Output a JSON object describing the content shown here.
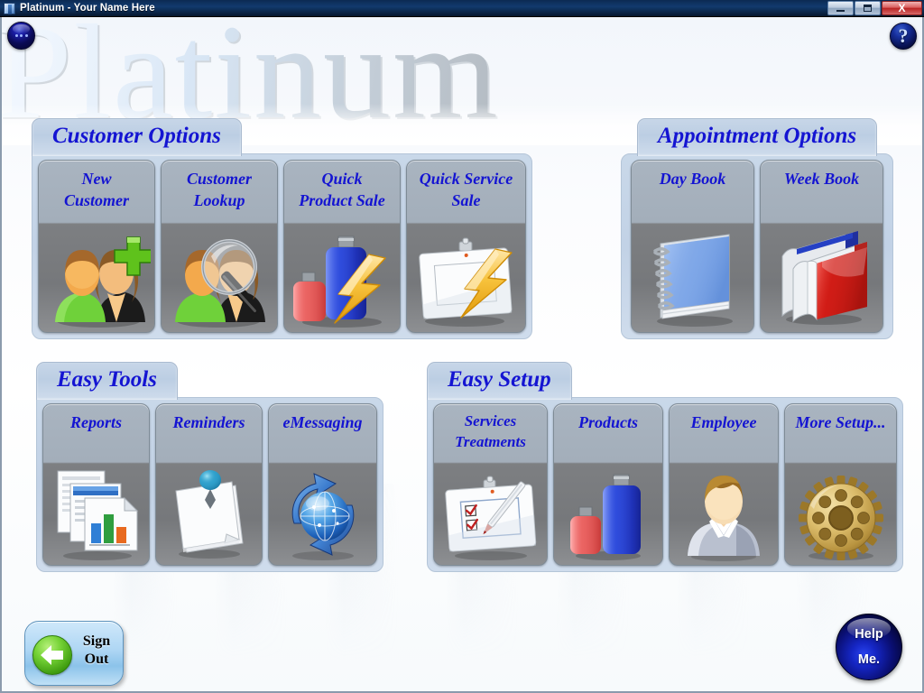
{
  "window": {
    "title": "Platinum - Your Name Here",
    "app_icon": "platinum-app-icon",
    "controls": {
      "minimize": "minimize",
      "maximize": "maximize",
      "close": "X"
    }
  },
  "header": {
    "wordmark": "Platinum",
    "menu_orb": "...",
    "help_orb": "?"
  },
  "colors": {
    "label_blue": "#1414d2",
    "tab_blue_gray": "#c7d6e8",
    "tile_gray_top": "#a9b4c0",
    "tile_gray_bottom": "#76787b",
    "titlebar_blue": "#123a6e",
    "close_red": "#b82222",
    "signout_green": "#3f9c10",
    "help_orb_blue": "#1526c4"
  },
  "groups": [
    {
      "id": "customer-options",
      "title": "Customer Options",
      "tiles": [
        {
          "id": "new-customer",
          "label": "New\nCustomer",
          "icon": "two-users-plus-icon"
        },
        {
          "id": "customer-lookup",
          "label": "Customer\nLookup",
          "icon": "user-magnifier-icon"
        },
        {
          "id": "quick-product-sale",
          "label": "Quick\nProduct Sale",
          "icon": "bottles-lightning-icon"
        },
        {
          "id": "quick-service-sale",
          "label": "Quick Service\nSale",
          "icon": "clipboard-lightning-icon"
        }
      ]
    },
    {
      "id": "appointment-options",
      "title": "Appointment Options",
      "tiles": [
        {
          "id": "day-book",
          "label": "Day Book",
          "icon": "spiral-notebook-icon"
        },
        {
          "id": "week-book",
          "label": "Week Book",
          "icon": "book-stack-icon"
        }
      ]
    },
    {
      "id": "easy-tools",
      "title": "Easy Tools",
      "tiles": [
        {
          "id": "reports",
          "label": "Reports",
          "icon": "documents-chart-icon"
        },
        {
          "id": "reminders",
          "label": "Reminders",
          "icon": "pinned-notes-icon"
        },
        {
          "id": "emessaging",
          "label": "eMessaging",
          "icon": "globe-sync-icon"
        }
      ]
    },
    {
      "id": "easy-setup",
      "title": "Easy Setup",
      "tiles": [
        {
          "id": "services-treatments",
          "label": "Services\nTreatments",
          "icon": "clipboard-checklist-pen-icon"
        },
        {
          "id": "products",
          "label": "Products",
          "icon": "bottles-icon"
        },
        {
          "id": "employee",
          "label": "Employee",
          "icon": "person-bust-icon"
        },
        {
          "id": "more-setup",
          "label": "More Setup...",
          "icon": "gear-icon"
        }
      ]
    }
  ],
  "footer": {
    "sign_out_label": "Sign\nOut",
    "sign_out_icon": "back-arrow-icon",
    "help_me_line1": "Help",
    "help_me_line2": "Me."
  }
}
